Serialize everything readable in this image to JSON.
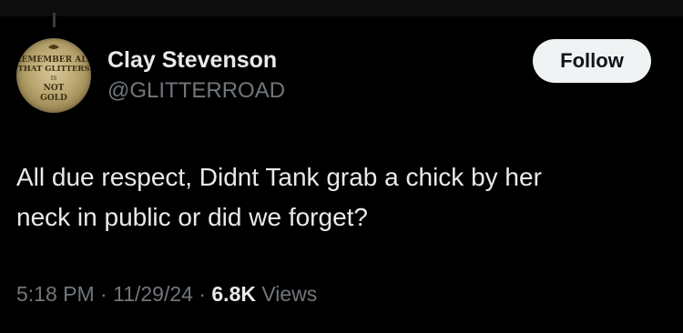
{
  "author": {
    "display_name": "Clay Stevenson",
    "handle": "@GLITTERROAD",
    "avatar_text": [
      "REMEMBER ALL",
      "THAT GLITTERS",
      "IS",
      "NOT",
      "GOLD"
    ]
  },
  "follow_label": "Follow",
  "tweet": {
    "text_line_1": "All due respect, Didnt Tank grab a chick by her",
    "text_line_2": "neck in public or did we forget?"
  },
  "meta": {
    "time": "5:18 PM",
    "separator": "·",
    "date": "11/29/24",
    "views_count": "6.8K",
    "views_label": "Views"
  },
  "colors": {
    "background": "#000000",
    "primary_text": "#e7e9ea",
    "secondary_text": "#71767b",
    "follow_bg": "#eff3f4"
  }
}
